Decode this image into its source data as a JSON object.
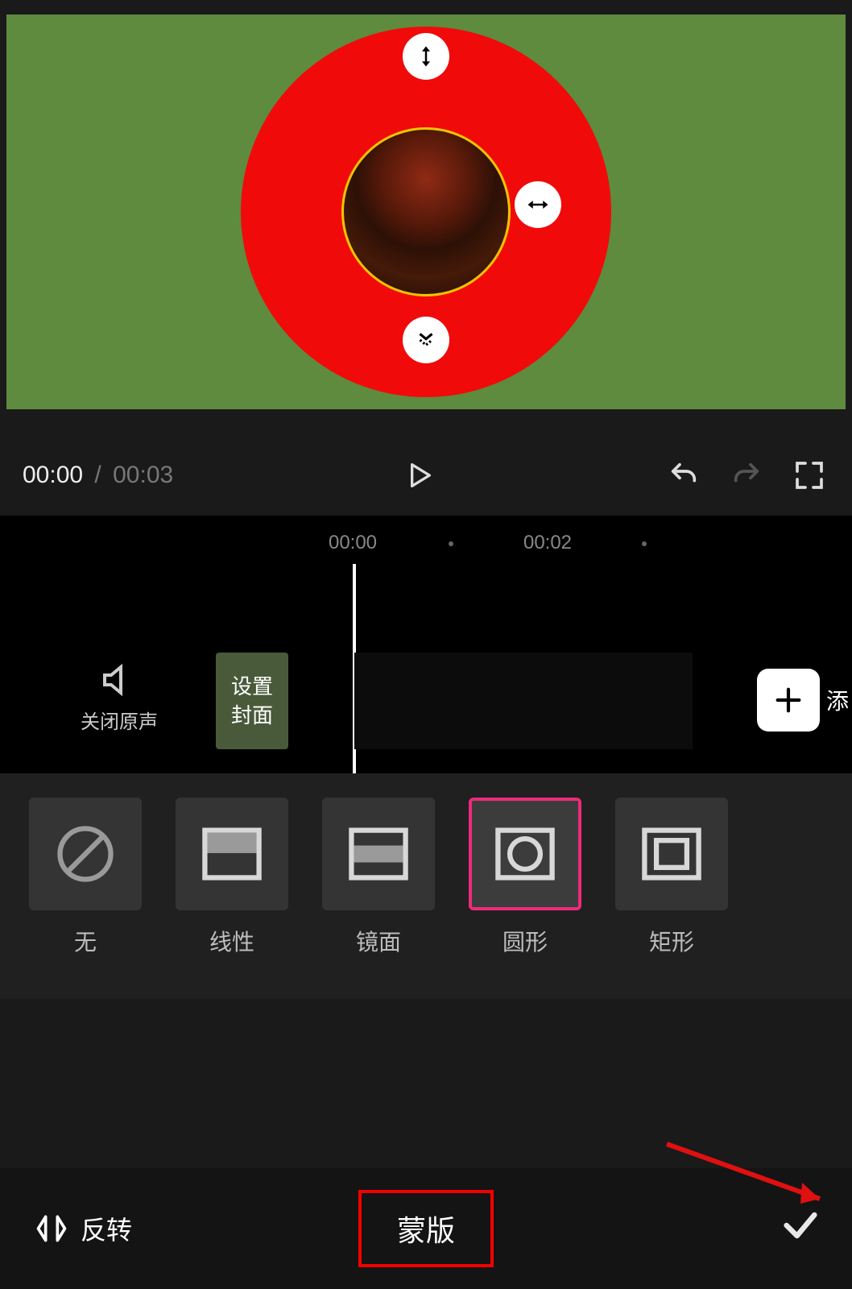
{
  "playback": {
    "current_time": "00:00",
    "separator": "/",
    "duration": "00:03"
  },
  "timeline": {
    "ruler": [
      "00:00",
      "00:02"
    ],
    "audio_toggle_label": "关闭原声",
    "cover_button_label": "设置\n封面",
    "add_label": "添"
  },
  "mask_options": [
    {
      "id": "none",
      "label": "无"
    },
    {
      "id": "linear",
      "label": "线性"
    },
    {
      "id": "mirror",
      "label": "镜面"
    },
    {
      "id": "circle",
      "label": "圆形",
      "selected": true
    },
    {
      "id": "rect",
      "label": "矩形"
    }
  ],
  "bottom": {
    "invert_label": "反转",
    "title_label": "蒙版"
  }
}
